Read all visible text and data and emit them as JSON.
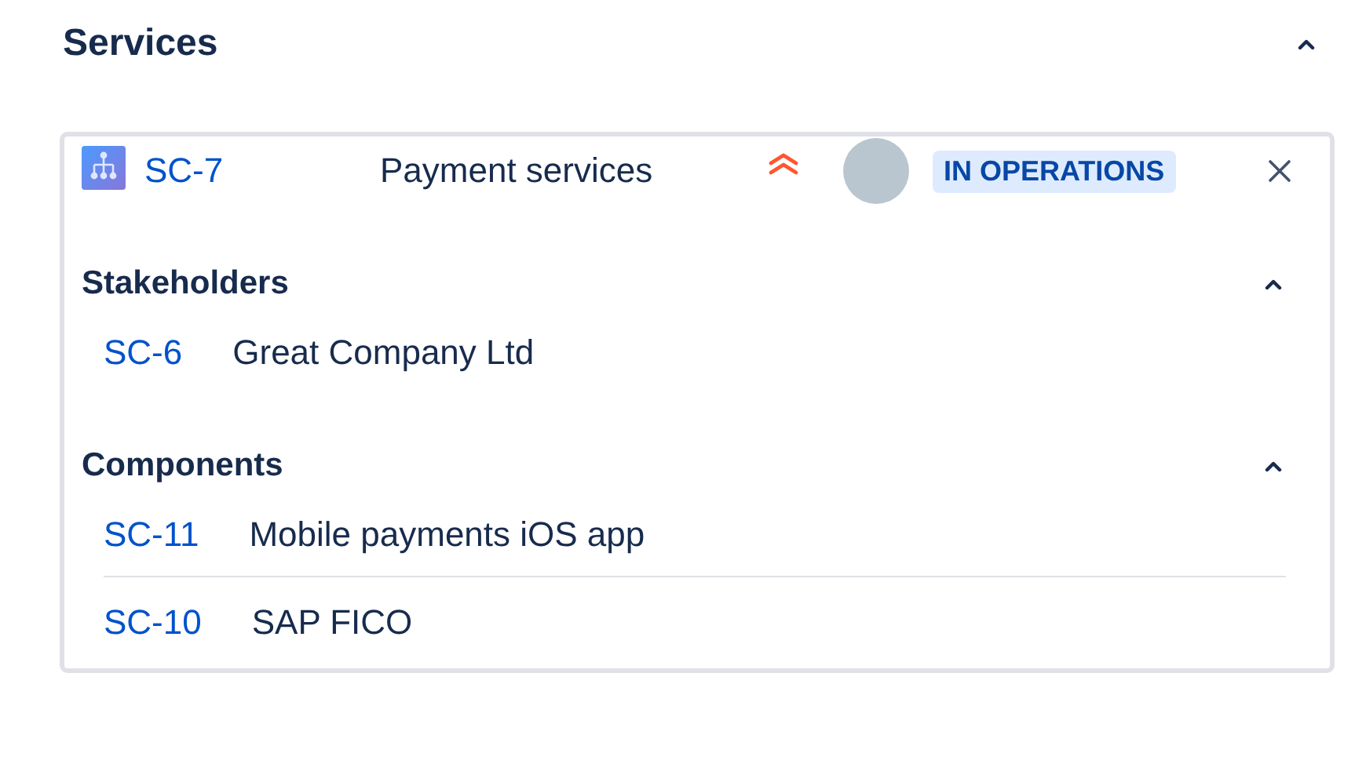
{
  "title": "Services",
  "expanded": true,
  "service": {
    "key": "SC-7",
    "name": "Payment services",
    "status": "IN OPERATIONS"
  },
  "sections": [
    {
      "title": "Stakeholders",
      "expanded": true,
      "items": [
        {
          "key": "SC-6",
          "name": "Great Company Ltd"
        }
      ]
    },
    {
      "title": "Components",
      "expanded": true,
      "items": [
        {
          "key": "SC-11",
          "name": "Mobile payments iOS app"
        },
        {
          "key": "SC-10",
          "name": "SAP FICO"
        }
      ]
    }
  ]
}
